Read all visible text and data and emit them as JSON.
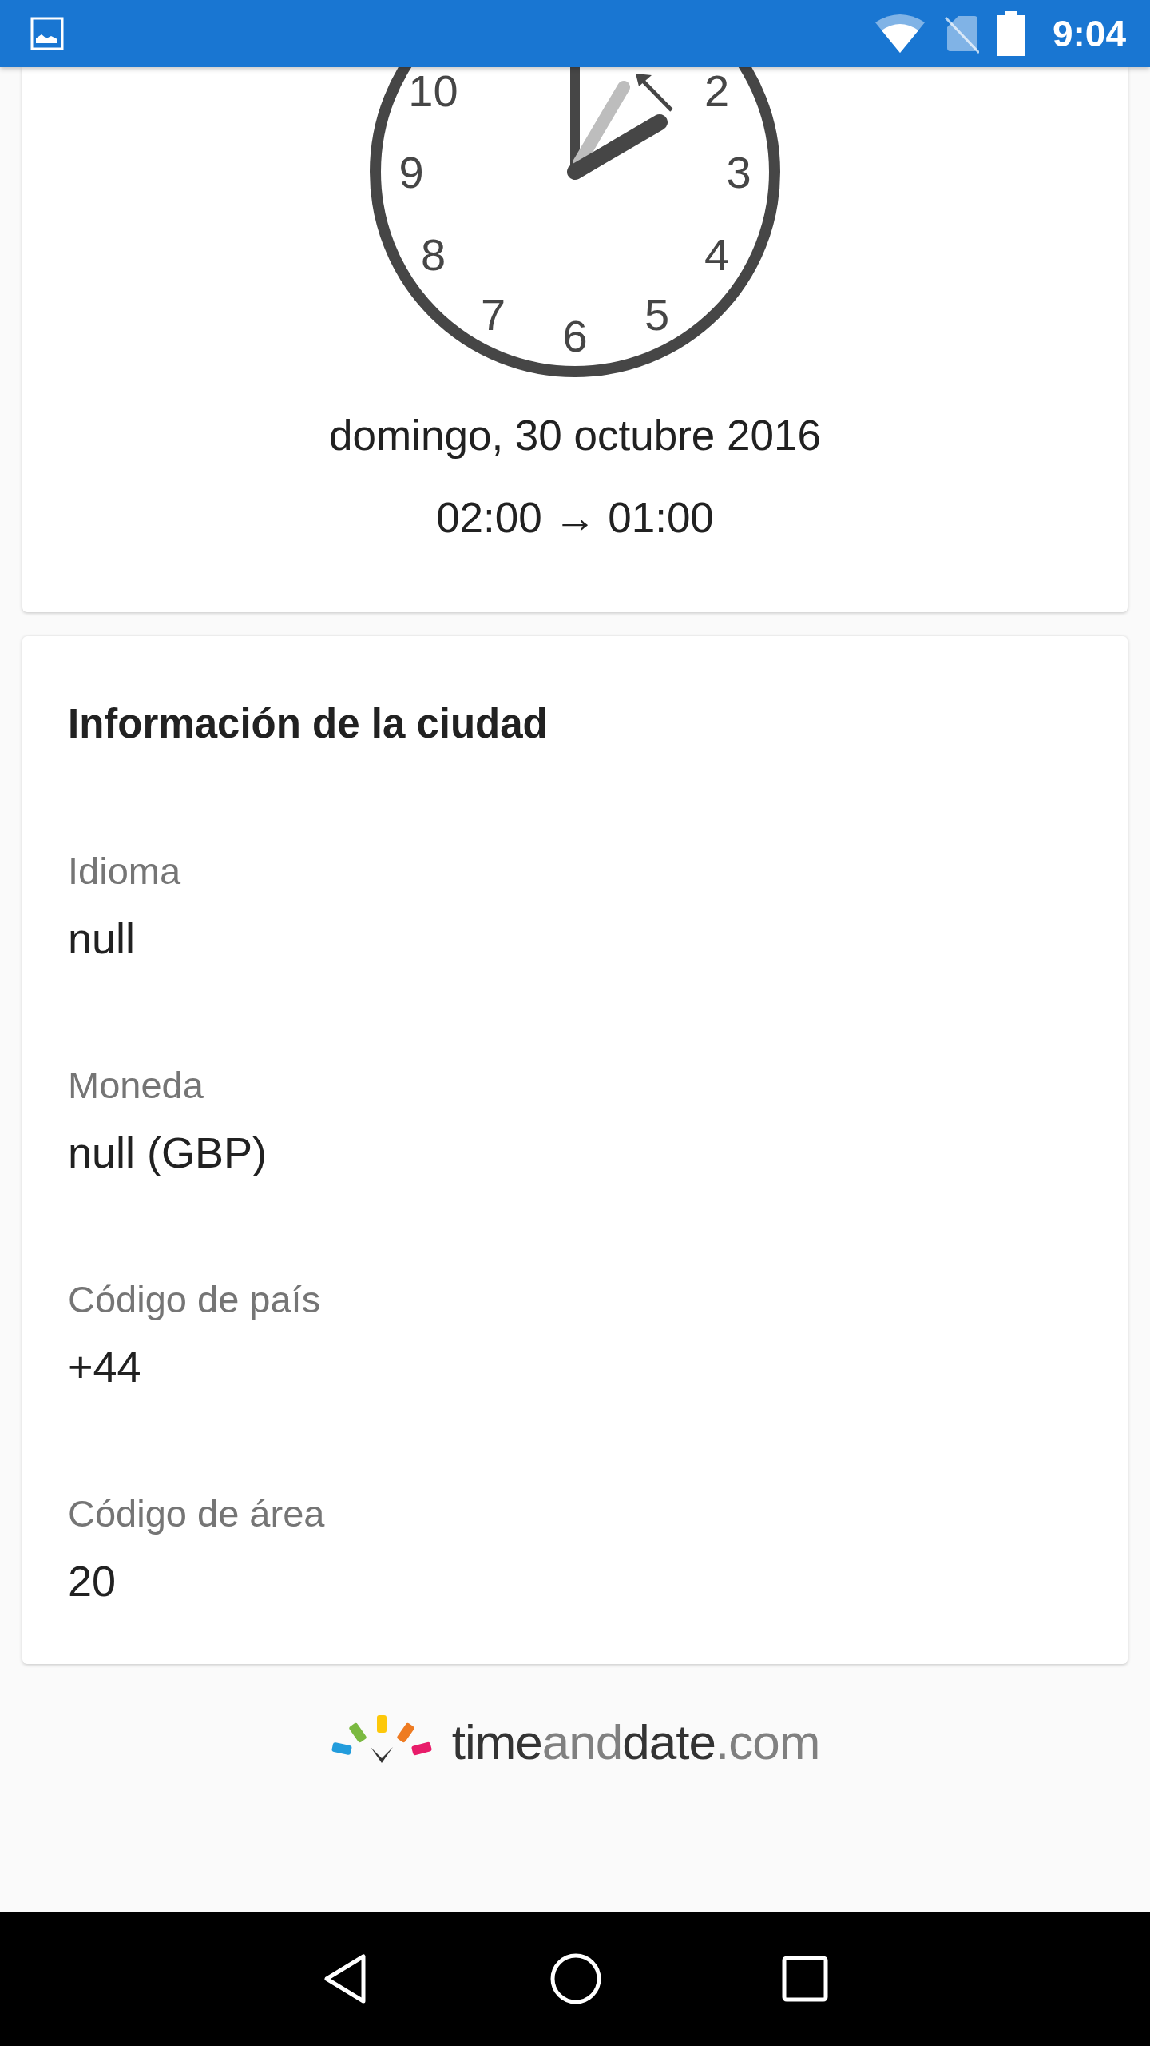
{
  "status_bar": {
    "time": "9:04"
  },
  "clock": {
    "numerals": [
      "2",
      "3",
      "4",
      "5",
      "6",
      "7",
      "8",
      "9",
      "10"
    ],
    "date": "domingo, 30 octubre 2016",
    "change": "02:00 → 01:00"
  },
  "city_info": {
    "title": "Información de la ciudad",
    "fields": [
      {
        "label": "Idioma",
        "value": "null"
      },
      {
        "label": "Moneda",
        "value": "null (GBP)"
      },
      {
        "label": "Código de país",
        "value": "+44"
      },
      {
        "label": "Código de área",
        "value": "20"
      }
    ]
  },
  "footer": {
    "logo_parts": [
      {
        "text": "time",
        "muted": false
      },
      {
        "text": "and",
        "muted": true
      },
      {
        "text": "date",
        "muted": false
      },
      {
        "text": ".com",
        "muted": true
      }
    ]
  }
}
